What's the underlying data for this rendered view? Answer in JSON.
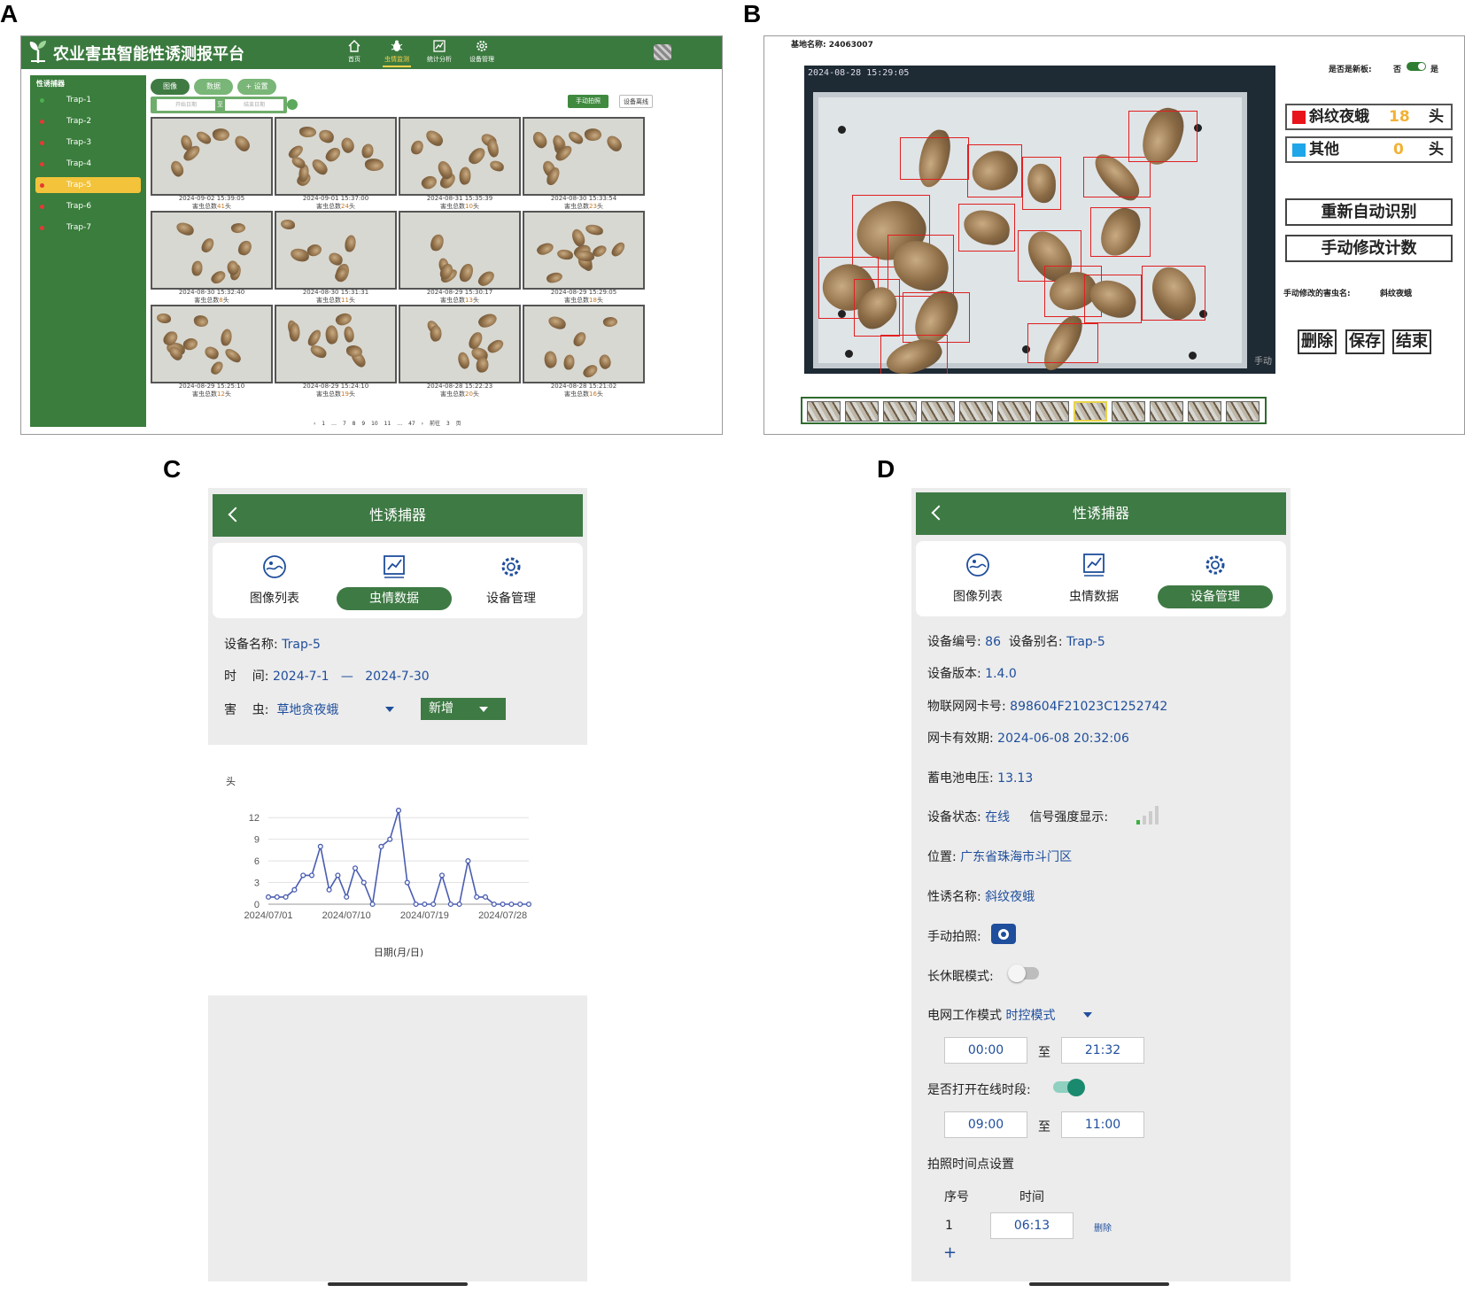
{
  "labels": {
    "a": "A",
    "b": "B",
    "c": "C",
    "d": "D"
  },
  "panelA": {
    "title": "农业害虫智能性诱测报平台",
    "nav": [
      {
        "label": "首页",
        "icon": "home-icon"
      },
      {
        "label": "虫情监测",
        "icon": "bug-icon"
      },
      {
        "label": "统计分析",
        "icon": "chart-icon"
      },
      {
        "label": "设备管理",
        "icon": "gear-icon"
      }
    ],
    "sidebar_title": "性诱捕器",
    "traps": [
      {
        "label": "Trap-1",
        "color": "#4caf50"
      },
      {
        "label": "Trap-2",
        "color": "#e53935"
      },
      {
        "label": "Trap-3",
        "color": "#e53935"
      },
      {
        "label": "Trap-4",
        "color": "#e53935"
      },
      {
        "label": "Trap-5",
        "color": "#e53935"
      },
      {
        "label": "Trap-6",
        "color": "#e53935"
      },
      {
        "label": "Trap-7",
        "color": "#e53935"
      }
    ],
    "tabs": {
      "image": "图像",
      "data": "数据",
      "settings": "+ 设置"
    },
    "date_start_placeholder": "开始日期",
    "date_sep": "至",
    "date_end_placeholder": "结束日期",
    "manual_photo": "手动拍照",
    "offline": "设备离线",
    "grid": [
      {
        "time": "2024-09-02 15:39:05",
        "count_prefix": "害虫总数",
        "count": "41",
        "unit": "头"
      },
      {
        "time": "2024-09-01 15:37:00",
        "count_prefix": "害虫总数",
        "count": "24",
        "unit": "头"
      },
      {
        "time": "2024-08-31 15:35:39",
        "count_prefix": "害虫总数",
        "count": "10",
        "unit": "头"
      },
      {
        "time": "2024-08-30 15:33:54",
        "count_prefix": "害虫总数",
        "count": "23",
        "unit": "头"
      },
      {
        "time": "2024-08-30 15:32:40",
        "count_prefix": "害虫总数",
        "count": "8",
        "unit": "头"
      },
      {
        "time": "2024-08-30 15:31:31",
        "count_prefix": "害虫总数",
        "count": "11",
        "unit": "头"
      },
      {
        "time": "2024-08-29 15:30:17",
        "count_prefix": "害虫总数",
        "count": "13",
        "unit": "头"
      },
      {
        "time": "2024-08-29 15:29:05",
        "count_prefix": "害虫总数",
        "count": "18",
        "unit": "头"
      },
      {
        "time": "2024-08-29 15:25:10",
        "count_prefix": "害虫总数",
        "count": "12",
        "unit": "头"
      },
      {
        "time": "2024-08-29 15:24:10",
        "count_prefix": "害虫总数",
        "count": "19",
        "unit": "头"
      },
      {
        "time": "2024-08-28 15:22:23",
        "count_prefix": "害虫总数",
        "count": "20",
        "unit": "头"
      },
      {
        "time": "2024-08-28 15:21:02",
        "count_prefix": "害虫总数",
        "count": "16",
        "unit": "头"
      }
    ],
    "pager": "‹ 1 … 7 8 9 10 11 … 47 › 前往 3 页"
  },
  "panelB": {
    "base_label": "基地名称: 24063007",
    "timestamp": "2024-08-28 15:29:05",
    "corner_text": "手动",
    "new_board_label": "是否是新板:",
    "no": "否",
    "yes": "是",
    "species": [
      {
        "name": "斜纹夜蛾",
        "count": "18",
        "unit": "头",
        "color": "#e8141a"
      },
      {
        "name": "其他",
        "count": "0",
        "unit": "头",
        "color": "#1ea6e8"
      }
    ],
    "btn_reidentify": "重新自动识别",
    "btn_manual": "手动修改计数",
    "manual_name_label": "手动修改的害虫名:",
    "manual_name_value": "斜纹夜蛾",
    "btn_delete": "删除",
    "btn_save": "保存",
    "btn_end": "结束"
  },
  "panelC": {
    "title": "性诱捕器",
    "tabs": [
      "图像列表",
      "虫情数据",
      "设备管理"
    ],
    "device_label": "设备名称:",
    "device_value": "Trap-5",
    "time_label": "时    间:",
    "time_start": "2024-7-1",
    "time_sep": "—",
    "time_end": "2024-7-30",
    "pest_label": "害    虫:",
    "pest_value": "草地贪夜蛾",
    "add_label": "新增",
    "y_unit": "头",
    "x_title": "日期(月/日)"
  },
  "chart_data": {
    "type": "line",
    "x": [
      "2024/07/01",
      "2024/07/02",
      "2024/07/03",
      "2024/07/04",
      "2024/07/05",
      "2024/07/06",
      "2024/07/07",
      "2024/07/08",
      "2024/07/09",
      "2024/07/10",
      "2024/07/11",
      "2024/07/12",
      "2024/07/13",
      "2024/07/14",
      "2024/07/15",
      "2024/07/16",
      "2024/07/17",
      "2024/07/18",
      "2024/07/19",
      "2024/07/20",
      "2024/07/21",
      "2024/07/22",
      "2024/07/23",
      "2024/07/24",
      "2024/07/25",
      "2024/07/26",
      "2024/07/27",
      "2024/07/28",
      "2024/07/29",
      "2024/07/30",
      "2024/07/31"
    ],
    "values": [
      1,
      1,
      1,
      2,
      4,
      4,
      8,
      2,
      4,
      1,
      5,
      3,
      0,
      8,
      9,
      13,
      3,
      0,
      0,
      0,
      4,
      0,
      0,
      6,
      1,
      1,
      0,
      0,
      0,
      0,
      0
    ],
    "xticks": [
      "2024/07/01",
      "2024/07/10",
      "2024/07/19",
      "2024/07/28"
    ],
    "yticks": [
      0,
      3,
      6,
      9,
      12
    ],
    "ylim": [
      0,
      13.5
    ],
    "ylabel": "头",
    "xlabel": "日期(月/日)",
    "color": "#4a5db0",
    "grid": true
  },
  "panelD": {
    "title": "性诱捕器",
    "tabs": [
      "图像列表",
      "虫情数据",
      "设备管理"
    ],
    "id_label": "设备编号:",
    "id_value": "86",
    "alias_label": "设备别名:",
    "alias_value": "Trap-5",
    "version_label": "设备版本:",
    "version_value": "1.4.0",
    "sim_label": "物联网网卡号:",
    "sim_value": "898604F21023C1252742",
    "expire_label": "网卡有效期:",
    "expire_value": "2024-06-08 20:32:06",
    "battery_label": "蓄电池电压:",
    "battery_value": "13.13",
    "status_label": "设备状态:",
    "status_value": "在线",
    "signal_label": "信号强度显示:",
    "location_label": "位置:",
    "location_value": "广东省珠海市斗门区",
    "lure_label": "性诱名称:",
    "lure_value": "斜纹夜蛾",
    "photo_label": "手动拍照:",
    "sleep_label": "长休眠模式:",
    "grid_label": "电网工作模式",
    "grid_value": "时控模式",
    "range1_start": "00:00",
    "range_sep": "至",
    "range1_end": "21:32",
    "online_label": "是否打开在线时段:",
    "range2_start": "09:00",
    "range2_end": "11:00",
    "schedule_label": "拍照时间点设置",
    "col_index": "序号",
    "col_time": "时间",
    "row_index": "1",
    "row_time": "06:13",
    "row_delete": "删除",
    "add": "+"
  }
}
